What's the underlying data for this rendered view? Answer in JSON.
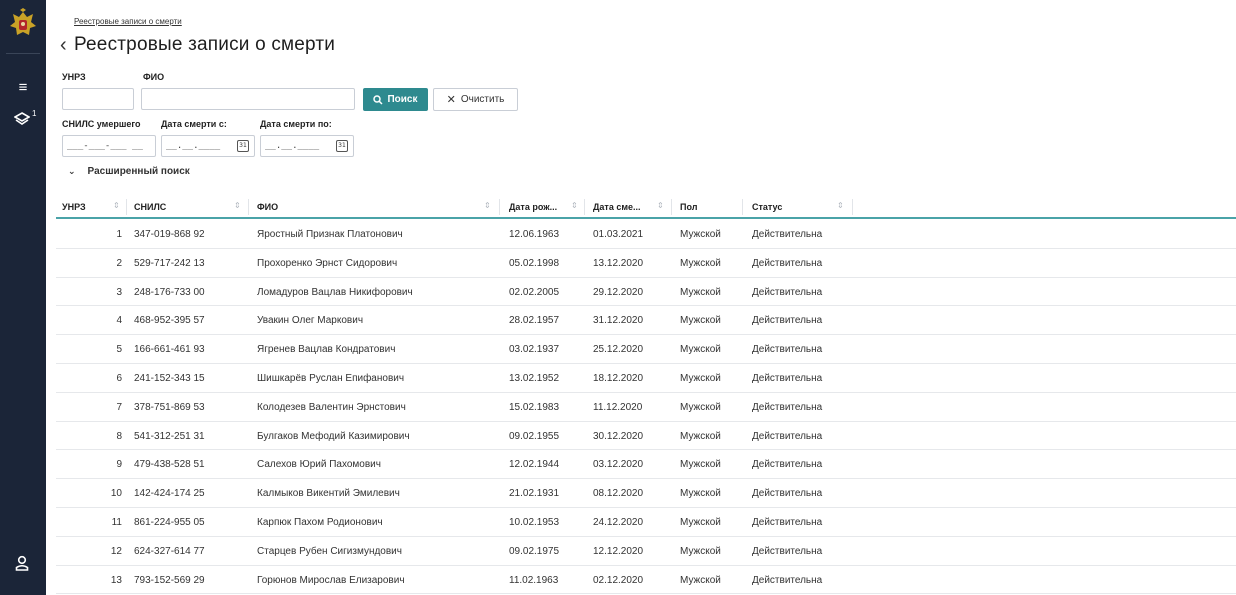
{
  "breadcrumb": "Реестровые записи о смерти",
  "title": "Реестровые записи о смерти",
  "sidebar": {
    "badge": "1"
  },
  "filters": {
    "unrz_label": "УНРЗ",
    "fio_label": "ФИО",
    "search_label": "Поиск",
    "clear_label": "Очистить",
    "snils_label": "СНИЛС умершего",
    "snils_mask": "___-___-___ __",
    "date_from_label": "Дата смерти с:",
    "date_from_mask": "__.__.____",
    "date_to_label": "Дата смерти по:",
    "date_to_mask": "__.__.____",
    "advanced_label": "Расширенный поиск"
  },
  "table": {
    "headers": [
      "УНРЗ",
      "СНИЛС",
      "ФИО",
      "Дата рож...",
      "Дата сме...",
      "Пол",
      "Статус"
    ],
    "rows": [
      [
        "1",
        "347-019-868 92",
        "Яростный Признак Платонович",
        "12.06.1963",
        "01.03.2021",
        "Мужской",
        "Действительна"
      ],
      [
        "2",
        "529-717-242 13",
        "Прохоренко Эрнст Сидорович",
        "05.02.1998",
        "13.12.2020",
        "Мужской",
        "Действительна"
      ],
      [
        "3",
        "248-176-733 00",
        "Ломадуров Вацлав Никифорович",
        "02.02.2005",
        "29.12.2020",
        "Мужской",
        "Действительна"
      ],
      [
        "4",
        "468-952-395 57",
        "Увакин Олег Маркович",
        "28.02.1957",
        "31.12.2020",
        "Мужской",
        "Действительна"
      ],
      [
        "5",
        "166-661-461 93",
        "Ягренев Вацлав Кондратович",
        "03.02.1937",
        "25.12.2020",
        "Мужской",
        "Действительна"
      ],
      [
        "6",
        "241-152-343 15",
        "Шишкарёв Руслан Епифанович",
        "13.02.1952",
        "18.12.2020",
        "Мужской",
        "Действительна"
      ],
      [
        "7",
        "378-751-869 53",
        "Колодезев Валентин Эрнстович",
        "15.02.1983",
        "11.12.2020",
        "Мужской",
        "Действительна"
      ],
      [
        "8",
        "541-312-251 31",
        "Булгаков Мефодий Казимирович",
        "09.02.1955",
        "30.12.2020",
        "Мужской",
        "Действительна"
      ],
      [
        "9",
        "479-438-528 51",
        "Салехов Юрий Пахомович",
        "12.02.1944",
        "03.12.2020",
        "Мужской",
        "Действительна"
      ],
      [
        "10",
        "142-424-174 25",
        "Калмыков Викентий Эмилевич",
        "21.02.1931",
        "08.12.2020",
        "Мужской",
        "Действительна"
      ],
      [
        "11",
        "861-224-955 05",
        "Карпюк Пахом Родионович",
        "10.02.1953",
        "24.12.2020",
        "Мужской",
        "Действительна"
      ],
      [
        "12",
        "624-327-614 77",
        "Старцев Рубен Сигизмундович",
        "09.02.1975",
        "12.12.2020",
        "Мужской",
        "Действительна"
      ],
      [
        "13",
        "793-152-569 29",
        "Горюнов Мирослав Елизарович",
        "11.02.1963",
        "02.12.2020",
        "Мужской",
        "Действительна"
      ]
    ]
  }
}
